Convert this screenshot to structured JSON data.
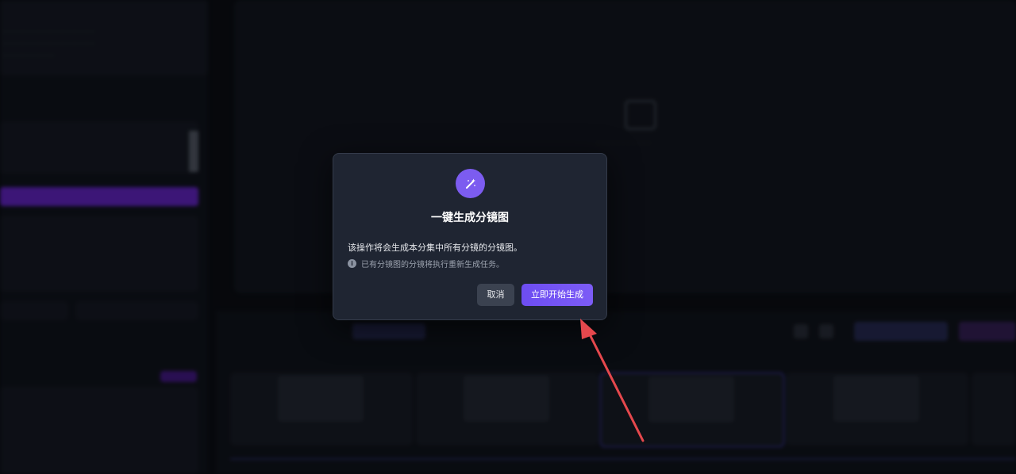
{
  "modal": {
    "title": "一键生成分镜图",
    "description": "该操作将会生成本分集中所有分镜的分镜图。",
    "note": "已有分镜图的分镜将执行重新生成任务。",
    "note_icon": "info-icon",
    "icon": "magic-wand-icon",
    "cancel_label": "取消",
    "confirm_label": "立即开始生成",
    "accent_color": "#7c5cf6"
  },
  "annotation": {
    "arrow_color": "#e5484d"
  }
}
